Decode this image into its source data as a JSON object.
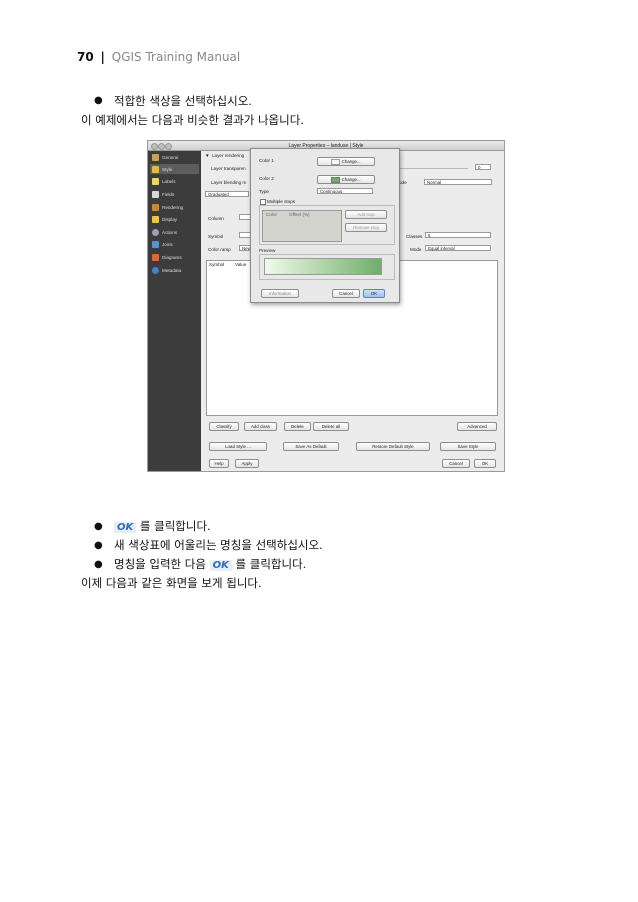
{
  "header": {
    "page_number": "70",
    "separator": "|",
    "manual_title": "QGIS Training Manual"
  },
  "body_text": {
    "line1": "적합한 색상을 선택하십시오.",
    "line2": "이 예제에서는 다음과 비슷한 결과가 나옵니다.",
    "line3_badge": "OK",
    "line3_text": "를 클릭합니다.",
    "line4": "새 색상표에 어울리는 명칭을 선택하십시오.",
    "line5_pre": "명칭을 입력한 다음",
    "line5_badge": "OK",
    "line5_text": "를 클릭합니다.",
    "line6": "이제 다음과 같은 화면을 보게 됩니다."
  },
  "window": {
    "title": "Layer Properties – landuse | Style",
    "sidebar": [
      "General",
      "Style",
      "Labels",
      "Fields",
      "Rendering",
      "Display",
      "Actions",
      "Joins",
      "Diagrams",
      "Metadata"
    ],
    "section_header": "Layer rendering",
    "transparency_label": "Layer transparen",
    "transparency_value": "0",
    "blending_label": "Layer blending m",
    "blend_mode_label": "Normal",
    "feature_mode_label": "ode",
    "feature_mode_value": "Normal",
    "renderer": "Graduated",
    "column_label": "Column",
    "symbol_label": "Symbol",
    "color_ramp_label": "Color ramp",
    "color_ramp_value": "New",
    "classes_label": "Classes",
    "classes_value": "5",
    "mode_label": "Mode",
    "mode_value": "Equal interval",
    "col_symbol": "Symbol",
    "col_value": "Value",
    "classify": "Classify",
    "add_class": "Add class",
    "delete": "Delete",
    "delete_all": "Delete all",
    "advanced": "Advanced",
    "load_style": "Load Style ...",
    "save_default": "Save As Default",
    "restore_default": "Restore Default Style",
    "save_style": "Save Style",
    "help": "Help",
    "apply": "Apply",
    "cancel": "Cancel",
    "ok": "OK"
  },
  "dialog": {
    "color1_label": "Color 1",
    "color2_label": "Color 2",
    "change": "Change...",
    "type_label": "Type",
    "type_value": "Continuous",
    "multiple_stops": "Multiple stops",
    "col_color": "Color",
    "col_offset": "Offset (%)",
    "add_stop": "Add stop",
    "remove_stop": "Remove stop",
    "preview_label": "Preview",
    "information": "Information",
    "cancel": "Cancel",
    "ok": "OK",
    "colors": {
      "color1": "#f2faea",
      "color2": "#6fae6a",
      "accent": "#3d7fd3"
    }
  }
}
